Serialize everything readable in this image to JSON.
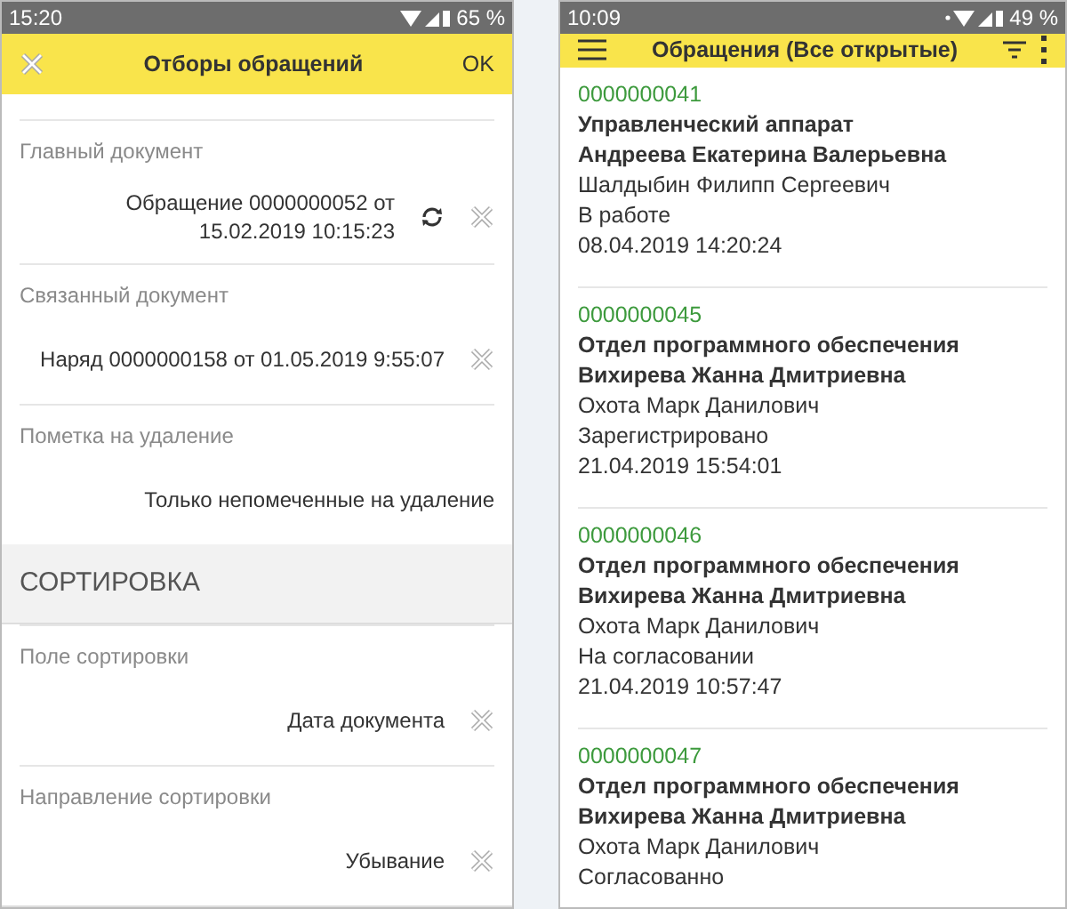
{
  "left_phone": {
    "status_bar": {
      "time": "15:20",
      "battery": "65 %"
    },
    "header": {
      "title": "Отборы обращений",
      "ok": "OK"
    },
    "filters": [
      {
        "label": "Главный документ",
        "value": "Обращение 0000000052 от 15.02.2019 10:15:23",
        "refresh": true,
        "clear": true
      },
      {
        "label": "Связанный документ",
        "value": "Наряд 0000000158 от 01.05.2019 9:55:07",
        "refresh": false,
        "clear": true
      },
      {
        "label": "Пометка на удаление",
        "value": "Только непомеченные на удаление",
        "refresh": false,
        "clear": false
      }
    ],
    "sort_section": {
      "title": "СОРТИРОВКА",
      "fields": [
        {
          "label": "Поле сортировки",
          "value": "Дата документа",
          "refresh": false,
          "clear": true
        },
        {
          "label": "Направление сортировки",
          "value": "Убывание",
          "refresh": false,
          "clear": true
        }
      ]
    }
  },
  "right_phone": {
    "status_bar": {
      "time": "10:09",
      "battery": "49 %"
    },
    "header": {
      "title": "Обращения (Все открытые)"
    },
    "items": [
      {
        "number": "0000000041",
        "department": "Управленческий аппарат",
        "author": "Андреева Екатерина Валерьевна",
        "executor": "Шалдыбин Филипп Сергеевич",
        "status": "В работе",
        "date": "08.04.2019 14:20:24"
      },
      {
        "number": "0000000045",
        "department": "Отдел программного обеспечения",
        "author": "Вихирева Жанна Дмитриевна",
        "executor": "Охота Марк Данилович",
        "status": "Зарегистрировано",
        "date": "21.04.2019 15:54:01"
      },
      {
        "number": "0000000046",
        "department": "Отдел программного обеспечения",
        "author": "Вихирева Жанна Дмитриевна",
        "executor": "Охота Марк Данилович",
        "status": "На согласовании",
        "date": "21.04.2019 10:57:47"
      },
      {
        "number": "0000000047",
        "department": "Отдел программного обеспечения",
        "author": "Вихирева Жанна Дмитриевна",
        "executor": "Охота Марк Данилович",
        "status": "Согласованно"
      }
    ]
  }
}
